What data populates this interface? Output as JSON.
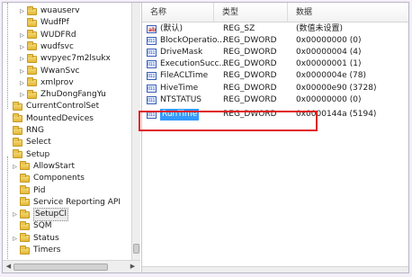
{
  "tree": {
    "items": [
      {
        "label": "wuauserv",
        "indent": 2,
        "expand": "▷"
      },
      {
        "label": "WudfPf",
        "indent": 2,
        "expand": ""
      },
      {
        "label": "WUDFRd",
        "indent": 2,
        "expand": "▷"
      },
      {
        "label": "wudfsvc",
        "indent": 2,
        "expand": "▷"
      },
      {
        "label": "wvpyec7m2lsukx",
        "indent": 2,
        "expand": "▷"
      },
      {
        "label": "WwanSvc",
        "indent": 2,
        "expand": "▷"
      },
      {
        "label": "xmlprov",
        "indent": 2,
        "expand": "▷"
      },
      {
        "label": "ZhuDongFangYu",
        "indent": 2,
        "expand": "▷"
      },
      {
        "label": "CurrentControlSet",
        "indent": 0,
        "expand": ""
      },
      {
        "label": "MountedDevices",
        "indent": 0,
        "expand": ""
      },
      {
        "label": "RNG",
        "indent": 0,
        "expand": ""
      },
      {
        "label": "Select",
        "indent": 0,
        "expand": ""
      },
      {
        "label": "Setup",
        "indent": 0,
        "expand": ""
      },
      {
        "label": "AllowStart",
        "indent": 1,
        "expand": "▷"
      },
      {
        "label": "Components",
        "indent": 1,
        "expand": ""
      },
      {
        "label": "Pid",
        "indent": 1,
        "expand": ""
      },
      {
        "label": "Service Reporting API",
        "indent": 1,
        "expand": ""
      },
      {
        "label": "SetupCl",
        "indent": 1,
        "expand": "▷",
        "selected": true
      },
      {
        "label": "SQM",
        "indent": 1,
        "expand": ""
      },
      {
        "label": "Status",
        "indent": 1,
        "expand": "▷"
      },
      {
        "label": "Timers",
        "indent": 1,
        "expand": ""
      }
    ]
  },
  "values": {
    "headers": {
      "name": "名称",
      "type": "类型",
      "data": "数据"
    },
    "rows": [
      {
        "name": "(默认)",
        "type": "REG_SZ",
        "data": "(数值未设置)",
        "icon": "string-value-icon"
      },
      {
        "name": "BlockOperatio...",
        "type": "REG_DWORD",
        "data": "0x00000000 (0)",
        "icon": "dword-value-icon"
      },
      {
        "name": "DriveMask",
        "type": "REG_DWORD",
        "data": "0x00000004 (4)",
        "icon": "dword-value-icon"
      },
      {
        "name": "ExecutionSucc...",
        "type": "REG_DWORD",
        "data": "0x00000001 (1)",
        "icon": "dword-value-icon"
      },
      {
        "name": "FileACLTime",
        "type": "REG_DWORD",
        "data": "0x0000004e (78)",
        "icon": "dword-value-icon"
      },
      {
        "name": "HiveTime",
        "type": "REG_DWORD",
        "data": "0x00000e90 (3728)",
        "icon": "dword-value-icon"
      },
      {
        "name": "NTSTATUS",
        "type": "REG_DWORD",
        "data": "0x00000000 (0)",
        "icon": "dword-value-icon"
      },
      {
        "name": "RunTime",
        "type": "REG_DWORD",
        "data": "0x0000144a (5194)",
        "icon": "dword-value-icon",
        "selected": true
      }
    ]
  },
  "colors": {
    "highlight_box": "#e02020",
    "selection": "#3399ff"
  }
}
